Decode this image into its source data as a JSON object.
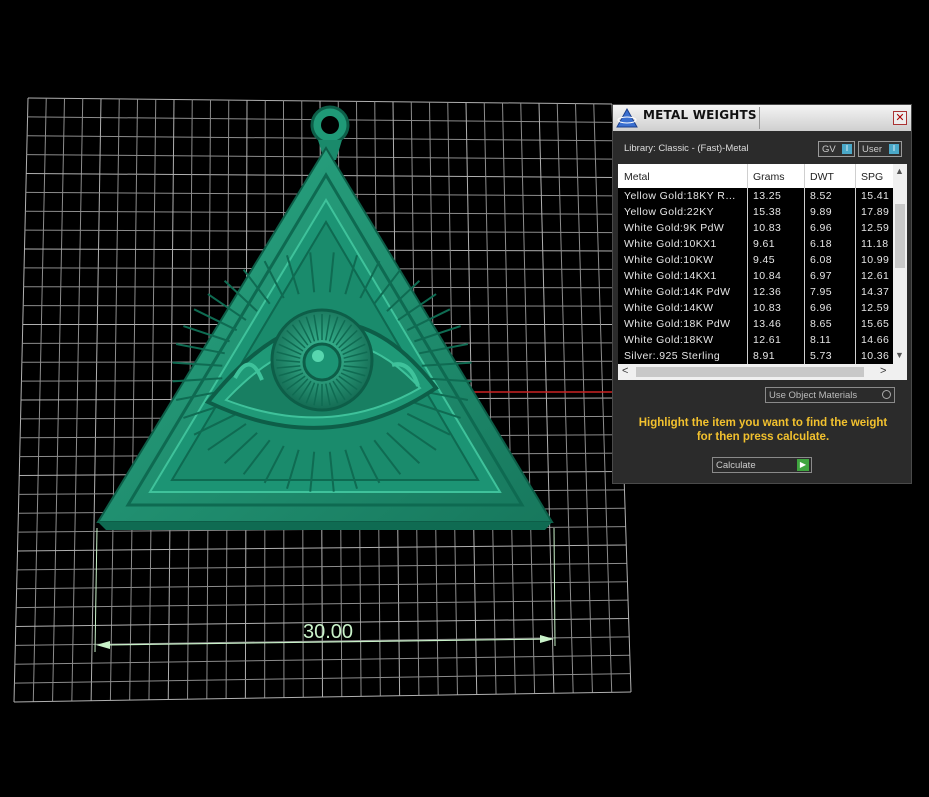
{
  "dimension": {
    "value": "30.00"
  },
  "panel": {
    "title": "METAL WEIGHTS",
    "close_icon": "close-icon",
    "library_label": "Library: Classic - (Fast)-Metal",
    "toggle_gv": "GV",
    "toggle_user": "User",
    "columns": [
      "Metal",
      "Grams",
      "DWT",
      "SPG"
    ],
    "rows": [
      [
        "Yellow Gold:18KY R…",
        "13.25",
        "8.52",
        "15.41"
      ],
      [
        "Yellow Gold:22KY",
        "15.38",
        "9.89",
        "17.89"
      ],
      [
        "White Gold:9K PdW",
        "10.83",
        "6.96",
        "12.59"
      ],
      [
        "White Gold:10KX1",
        "9.61",
        "6.18",
        "11.18"
      ],
      [
        "White Gold:10KW",
        "9.45",
        "6.08",
        "10.99"
      ],
      [
        "White Gold:14KX1",
        "10.84",
        "6.97",
        "12.61"
      ],
      [
        "White Gold:14K PdW",
        "12.36",
        "7.95",
        "14.37"
      ],
      [
        "White Gold:14KW",
        "10.83",
        "6.96",
        "12.59"
      ],
      [
        "White Gold:18K PdW",
        "13.46",
        "8.65",
        "15.65"
      ],
      [
        "White Gold:18KW",
        "12.61",
        "8.11",
        "14.66"
      ],
      [
        "Silver:.925 Sterling",
        "8.91",
        "5.73",
        "10.36"
      ]
    ],
    "use_object_materials": "Use Object Materials",
    "hint_line1": "Highlight the item you want to find the weight",
    "hint_line2": "for then press calculate.",
    "calculate": "Calculate"
  },
  "colors": {
    "pendant": "#1f9977",
    "pendant_dark": "#0d5e48",
    "pendant_light": "#3fc29b",
    "grid": "#8c8c8c",
    "dimension": "#c9f2c9",
    "hint": "#f2c12e",
    "axis": "#cc2222"
  }
}
